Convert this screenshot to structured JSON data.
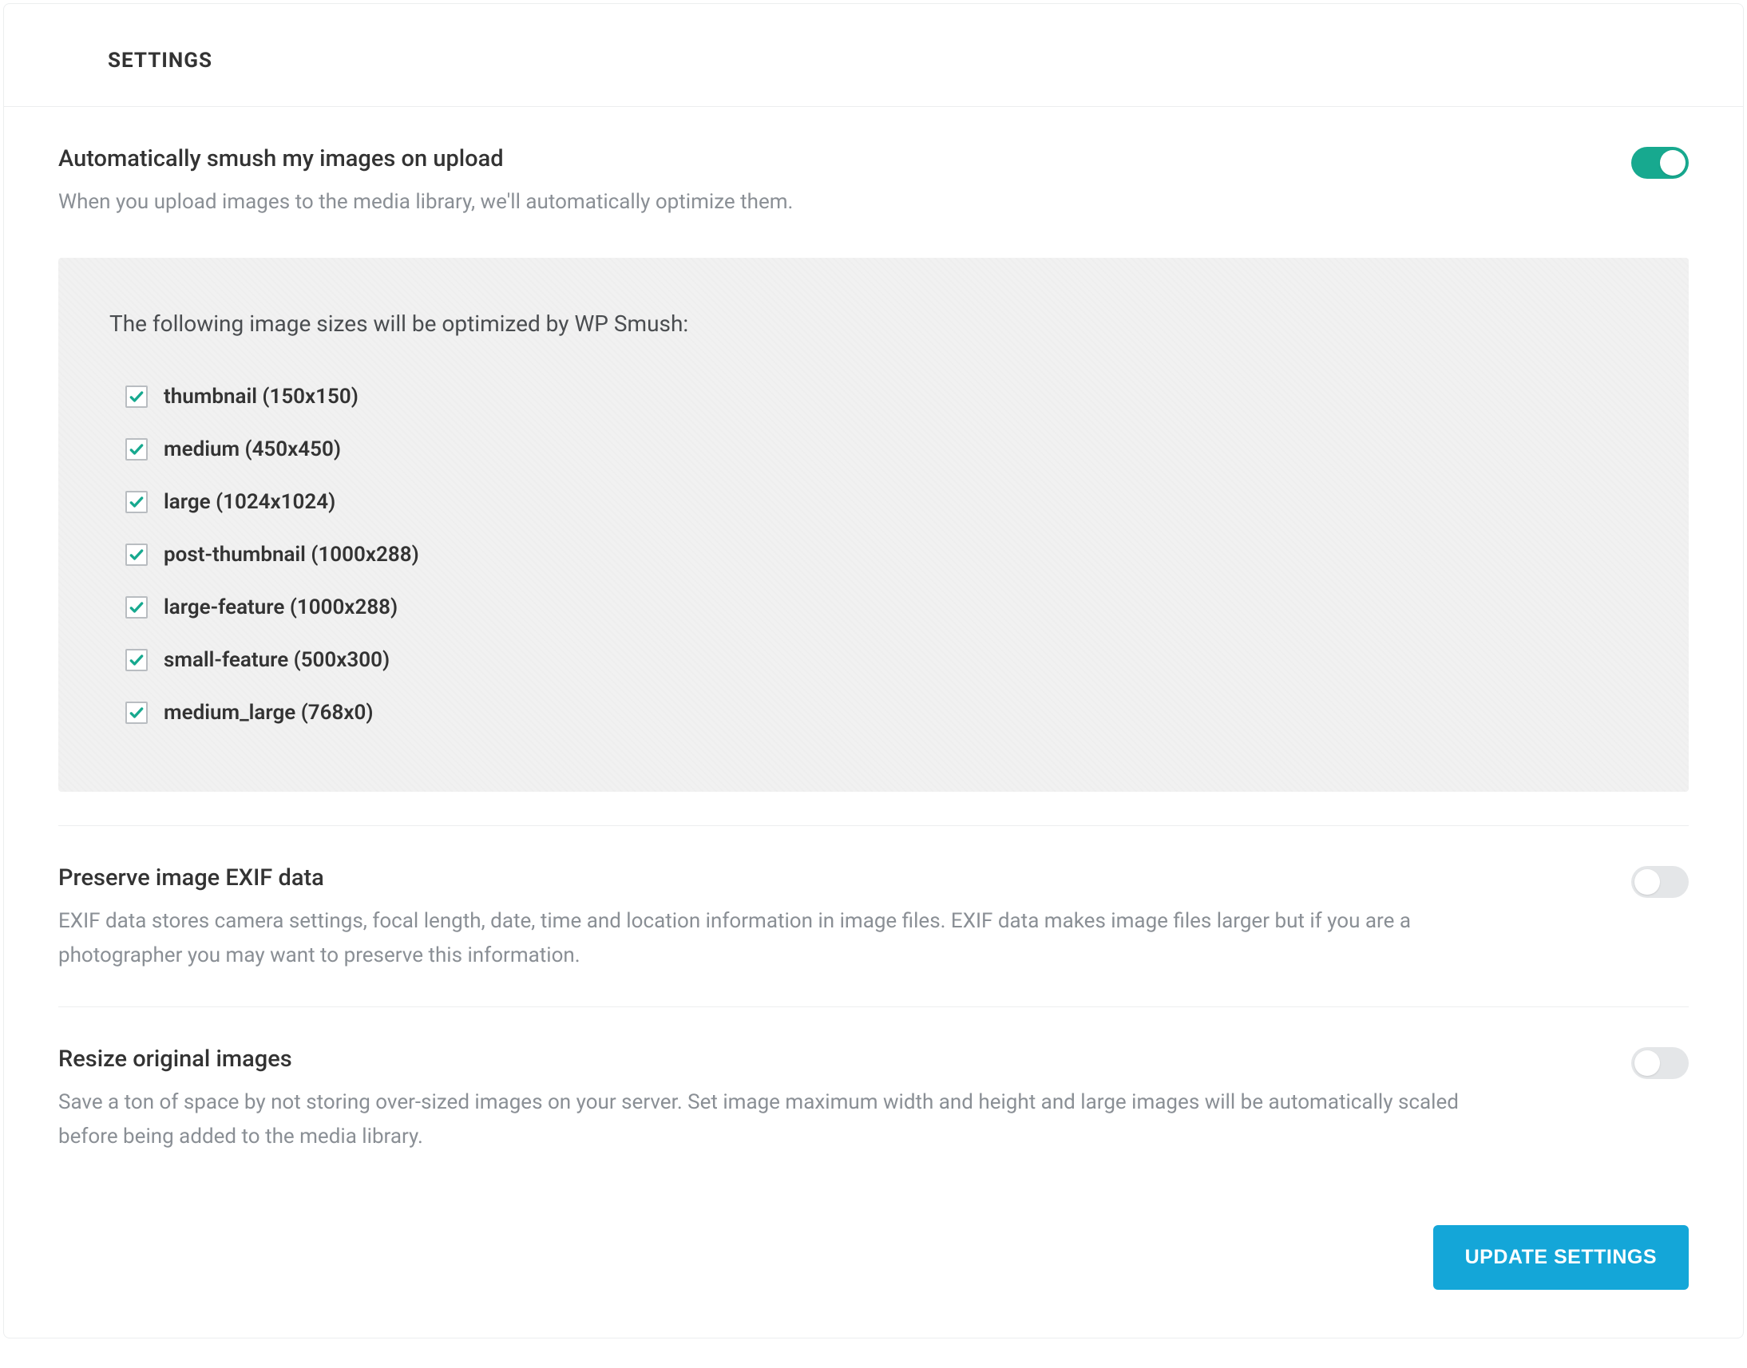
{
  "header": {
    "title": "SETTINGS"
  },
  "autoSmush": {
    "title": "Automatically smush my images on upload",
    "desc": "When you upload images to the media library, we'll automatically optimize them.",
    "enabled": true,
    "sizesIntro": "The following image sizes will be optimized by WP Smush:",
    "sizes": [
      {
        "label": "thumbnail (150x150)",
        "checked": true
      },
      {
        "label": "medium (450x450)",
        "checked": true
      },
      {
        "label": "large (1024x1024)",
        "checked": true
      },
      {
        "label": "post-thumbnail (1000x288)",
        "checked": true
      },
      {
        "label": "large-feature (1000x288)",
        "checked": true
      },
      {
        "label": "small-feature (500x300)",
        "checked": true
      },
      {
        "label": "medium_large (768x0)",
        "checked": true
      }
    ]
  },
  "exif": {
    "title": "Preserve image EXIF data",
    "desc": "EXIF data stores camera settings, focal length, date, time and location information in image files. EXIF data makes image files larger but if you are a photographer you may want to preserve this information.",
    "enabled": false
  },
  "resize": {
    "title": "Resize original images",
    "desc": "Save a ton of space by not storing over-sized images on your server. Set image maximum width and height and large images will be automatically scaled before being added to the media library.",
    "enabled": false
  },
  "footer": {
    "updateLabel": "UPDATE SETTINGS"
  },
  "colors": {
    "accent": "#14a6d8",
    "toggleOn": "#17a98f"
  }
}
